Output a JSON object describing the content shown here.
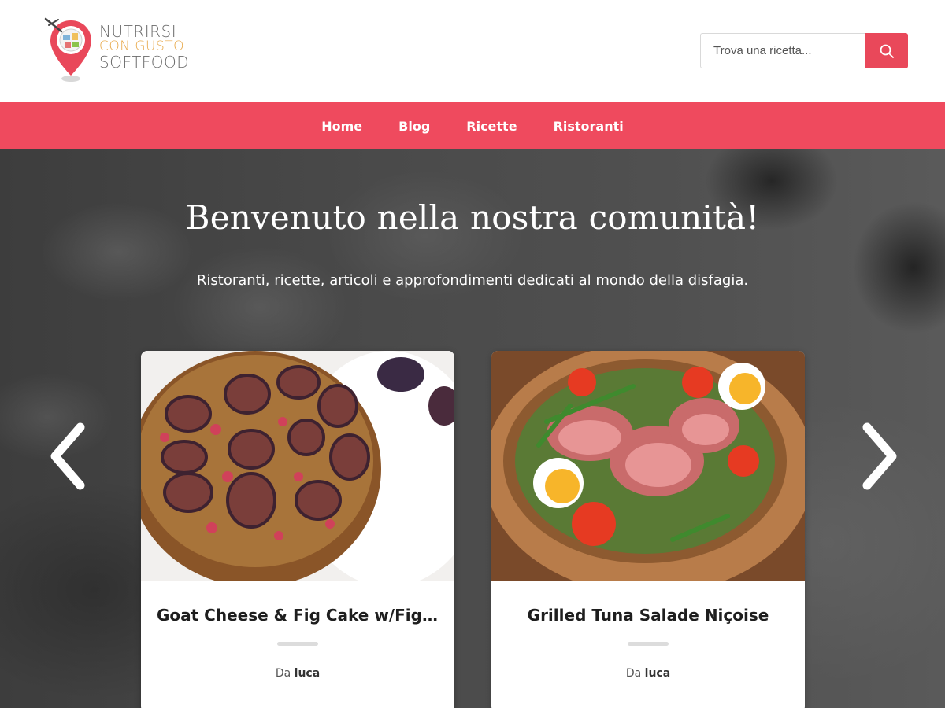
{
  "header": {
    "logo": {
      "line1": "NUTRIRSI",
      "line2": "CON GUSTO",
      "line3": "SOFTFOOD",
      "icon": "map-pin-icon",
      "colors": {
        "pin": "#e9485a",
        "text": "#6b6b6b",
        "accent": "#e8a94a"
      }
    },
    "search": {
      "placeholder": "Trova una ricetta...",
      "value": "",
      "button_icon": "search-icon"
    }
  },
  "nav": {
    "background": "#ef4a5e",
    "items": [
      {
        "label": "Home"
      },
      {
        "label": "Blog"
      },
      {
        "label": "Ricette"
      },
      {
        "label": "Ristoranti"
      }
    ]
  },
  "hero": {
    "title": "Benvenuto nella nostra comunità!",
    "subtitle": "Ristoranti, ricette, articoli e approfondimenti dedicati al mondo della disfagia.",
    "prev_icon": "chevron-left-icon",
    "next_icon": "chevron-right-icon"
  },
  "cards": [
    {
      "title": "Goat Cheese & Fig Cake w/Fig ...",
      "author_prefix": "Da",
      "author": "luca",
      "image": "fig-cake-photo"
    },
    {
      "title": "Grilled Tuna Salade Niçoise",
      "author_prefix": "Da",
      "author": "luca",
      "image": "tuna-salad-photo"
    }
  ]
}
